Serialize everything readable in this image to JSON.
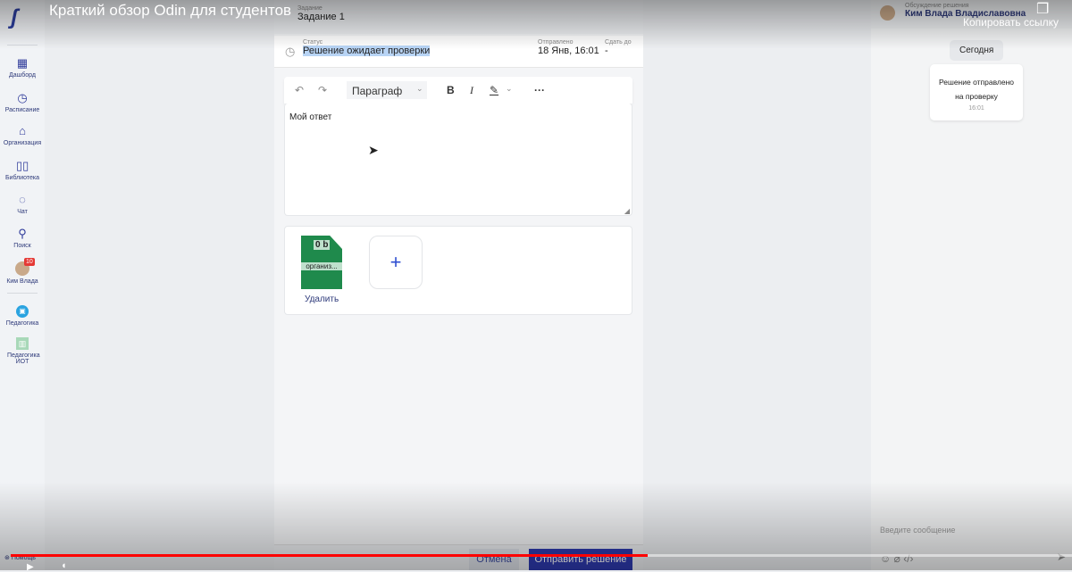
{
  "video": {
    "title": "Краткий обзор Odin для студентов",
    "copy_link": "Копировать ссылку",
    "progress_percent": 60
  },
  "sidebar": {
    "items": [
      {
        "label": "Дашборд"
      },
      {
        "label": "Расписание"
      },
      {
        "label": "Организация"
      },
      {
        "label": "Библиотека"
      },
      {
        "label": "Чат"
      },
      {
        "label": "Поиск"
      },
      {
        "label": "Ким Влада",
        "badge": "10"
      },
      {
        "label": "Педагогика"
      },
      {
        "label": "Педагогика ИОТ"
      }
    ],
    "help": "Помощь"
  },
  "task": {
    "label": "Задание",
    "name": "Задание 1"
  },
  "status": {
    "label": "Статус",
    "value": "Решение ожидает проверки",
    "sent_label": "Отправлено",
    "sent_value": "18 Янв, 16:01",
    "due_label": "Сдать до",
    "due_value": "-"
  },
  "editor": {
    "paragraph": "Параграф",
    "content": "Мой ответ"
  },
  "attachment": {
    "size": "0 b",
    "name": "организ...",
    "delete": "Удалить"
  },
  "actions": {
    "cancel": "Отмена",
    "submit": "Отправить решение"
  },
  "chat": {
    "label": "Обсуждение решения",
    "user": "Ким Влада Владиславовна",
    "date": "Сегодня",
    "message": "Решение отправлено на проверку",
    "time": "16:01",
    "placeholder": "Введите сообщение"
  },
  "colors": {
    "accent": "#2e3ab0",
    "green": "#1f8a4c"
  }
}
